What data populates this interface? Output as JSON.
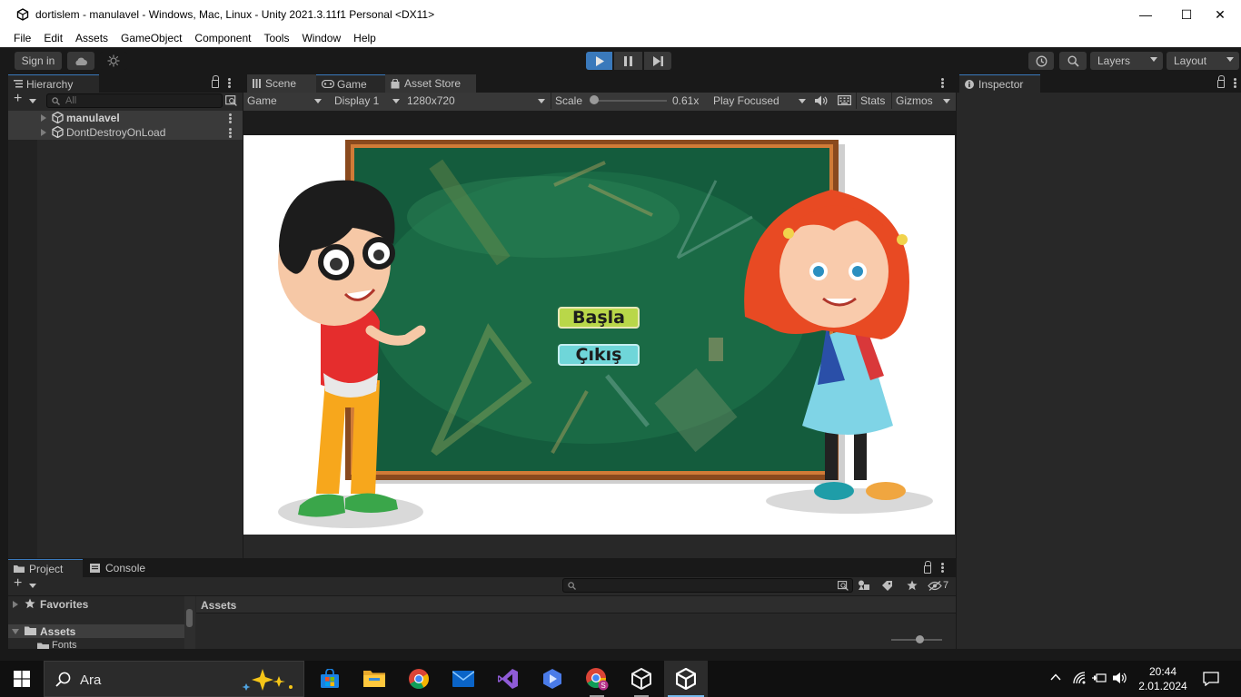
{
  "window": {
    "title": "dortislem - manulavel - Windows, Mac, Linux - Unity 2021.3.11f1 Personal <DX11>",
    "minimize_glyph": "—",
    "maximize_glyph": "☐",
    "close_glyph": "✕"
  },
  "menu": [
    "File",
    "Edit",
    "Assets",
    "GameObject",
    "Component",
    "Tools",
    "Window",
    "Help"
  ],
  "toolbar": {
    "sign_in": "Sign in",
    "layers": "Layers",
    "layout": "Layout"
  },
  "hierarchy": {
    "tab": "Hierarchy",
    "search_placeholder": "All",
    "items": [
      {
        "label": "manulavel"
      },
      {
        "label": "DontDestroyOnLoad"
      }
    ]
  },
  "view_tabs": {
    "scene": "Scene",
    "game": "Game",
    "asset_store": "Asset Store"
  },
  "game_controls": {
    "mode": "Game",
    "display": "Display 1",
    "resolution": "1280x720",
    "scale_label": "Scale",
    "scale_value": "0.61x",
    "scale_fraction": 0.0,
    "play_mode": "Play Focused",
    "stats": "Stats",
    "gizmos": "Gizmos"
  },
  "game": {
    "start_button": "Başla",
    "exit_button": "Çıkış",
    "colors": {
      "start_button": "#b9d749",
      "exit_button": "#6fd6d9",
      "board": "#145c3d",
      "board_frame": "#8a4a1e"
    }
  },
  "inspector": {
    "tab": "Inspector"
  },
  "project": {
    "project_tab": "Project",
    "console_tab": "Console",
    "favorites": "Favorites",
    "assets_folder": "Assets",
    "fonts_folder": "Fonts",
    "assets_header": "Assets",
    "hidden_count": "7"
  },
  "taskbar": {
    "search_text": "Ara",
    "time": "20:44",
    "date": "2.01.2024"
  },
  "colors": {
    "accent": "#3a79bb",
    "play_active": "#3a79bb"
  }
}
